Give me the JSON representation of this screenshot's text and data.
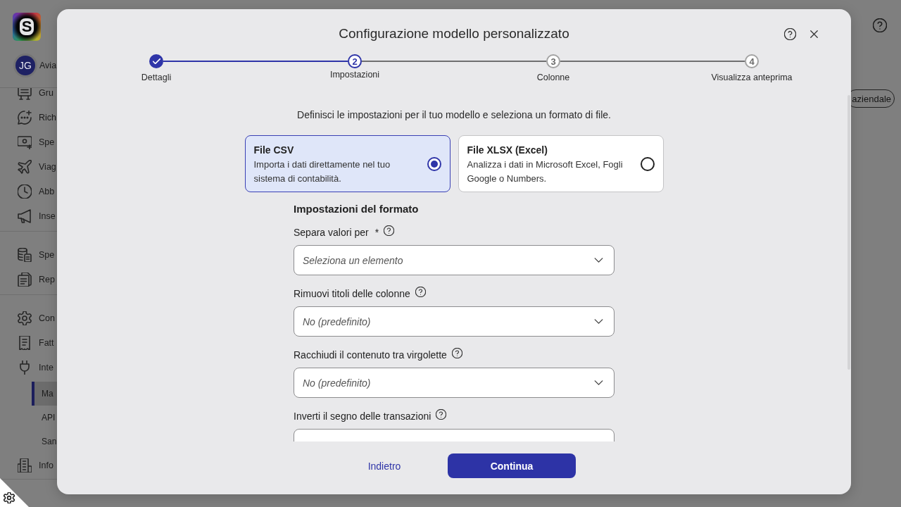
{
  "app": {
    "logo": {
      "letter": "S"
    },
    "account": {
      "initials": "JG",
      "name": "Avia"
    },
    "sidebar": {
      "groups": [
        {
          "items": [
            {
              "label": "Gru",
              "selected": false
            },
            {
              "label": "Rich",
              "selected": false
            },
            {
              "label": "Spe",
              "selected": false
            },
            {
              "label": "Viag",
              "selected": false
            },
            {
              "label": "Abb",
              "selected": false
            },
            {
              "label": "Inse",
              "selected": false
            }
          ]
        },
        {
          "items": [
            {
              "label": "Spe",
              "selected": false
            },
            {
              "label": "Rep",
              "selected": false
            }
          ]
        },
        {
          "items": [
            {
              "label": "Con",
              "selected": false
            },
            {
              "label": "Fatt",
              "selected": false
            },
            {
              "label": "Inte",
              "selected": false,
              "children": [
                {
                  "label": "Ma",
                  "selected": true
                },
                {
                  "label": "API",
                  "selected": false
                },
                {
                  "label": "San",
                  "selected": false
                }
              ]
            },
            {
              "label": "Info",
              "selected": false
            }
          ]
        }
      ]
    },
    "header_button": {
      "label": "aziendale"
    }
  },
  "dialog": {
    "title": "Configurazione modello personalizzato",
    "steps": [
      {
        "label": "Dettagli",
        "completed": true,
        "selected": false
      },
      {
        "number": "2",
        "label": "Impostazioni",
        "completed": false,
        "selected": true
      },
      {
        "number": "3",
        "label": "Colonne",
        "completed": false,
        "selected": false
      },
      {
        "number": "4",
        "label": "Visualizza anteprima",
        "completed": false,
        "selected": false
      }
    ],
    "intro": "Definisci le impostazioni per il tuo modello e seleziona un formato di file.",
    "format_options": [
      {
        "title": "File CSV",
        "description": "Importa i dati direttamente nel tuo sistema di contabilità.",
        "selected": true
      },
      {
        "title": "File XLSX (Excel)",
        "description": "Analizza i dati in Microsoft Excel, Fogli Google o Numbers.",
        "selected": false
      }
    ],
    "section_title": "Impostazioni del formato",
    "fields": [
      {
        "label": "Separa valori per",
        "required_mark": "*",
        "placeholder": "Seleziona un elemento"
      },
      {
        "label": "Rimuovi titoli delle colonne",
        "placeholder": "No (predefinito)"
      },
      {
        "label": "Racchiudi il contenuto tra virgolette",
        "placeholder": "No (predefinito)"
      },
      {
        "label": "Inverti il segno delle transazioni"
      }
    ],
    "actions": {
      "back": "Indietro",
      "continue": "Continua"
    }
  }
}
